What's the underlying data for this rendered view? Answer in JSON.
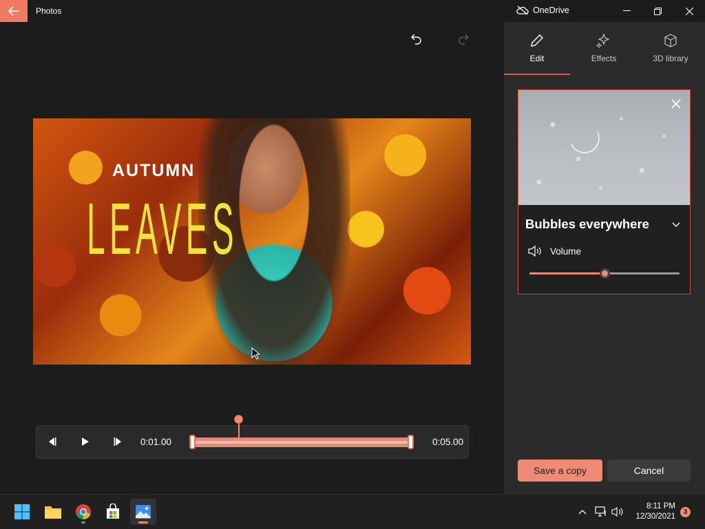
{
  "titlebar": {
    "app_title": "Photos",
    "onedrive_label": "OneDrive"
  },
  "preview": {
    "overlay_title": "AUTUMN",
    "overlay_subtitle": "LEAVES"
  },
  "playback": {
    "current_time": "0:01.00",
    "end_time": "0:05.00"
  },
  "panel": {
    "tabs": [
      {
        "label": "Edit",
        "icon": "pencil-icon",
        "selected": true
      },
      {
        "label": "Effects",
        "icon": "sparkles-icon"
      },
      {
        "label": "3D library",
        "icon": "cube-icon"
      }
    ],
    "effect": {
      "name": "Bubbles everywhere",
      "volume_label": "Volume",
      "volume_level": 0.5
    },
    "save_label": "Save a copy",
    "cancel_label": "Cancel"
  },
  "taskbar": {
    "apps": [
      "windows-start-icon",
      "file-explorer-icon",
      "chrome-icon",
      "store-icon",
      "photos-icon"
    ],
    "time": "8:11 PM",
    "date": "12/30/2021",
    "notification_count": "3"
  },
  "colors": {
    "accent": "#ef8a74",
    "background": "#1c1c1c",
    "panel": "#2b2b2b"
  }
}
